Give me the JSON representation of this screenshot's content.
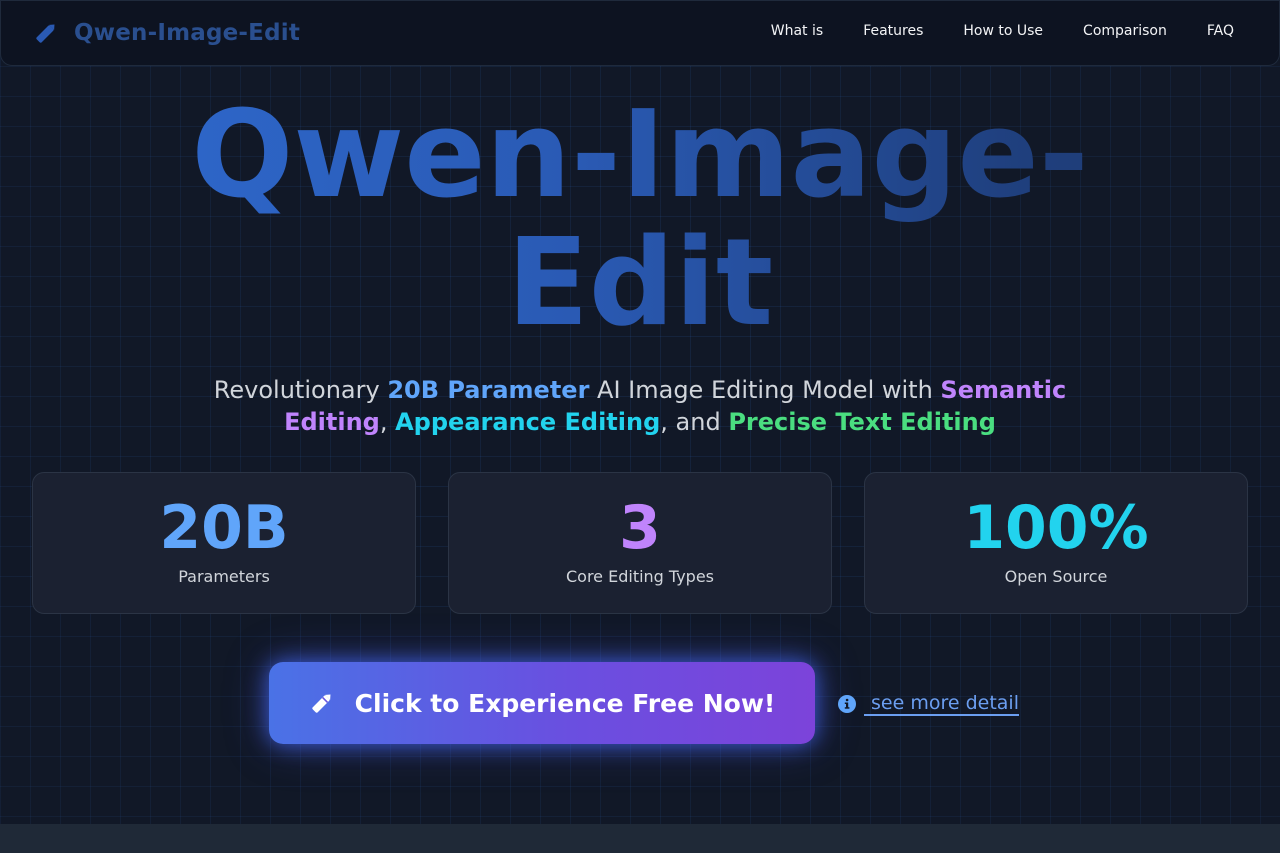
{
  "colors": {
    "accent_blue": "#60a5fa",
    "accent_purple": "#c084fc",
    "accent_cyan": "#22d3ee",
    "accent_green": "#4ade80",
    "background": "#111827",
    "brand": "#2a4f8f"
  },
  "nav": {
    "brand_icon": "pencil-icon",
    "brand": "Qwen-Image-Edit",
    "links": [
      "What is",
      "Features",
      "How to Use",
      "Comparison",
      "FAQ"
    ]
  },
  "hero": {
    "title_line1": "Qwen-Image-",
    "title_line2": "Edit",
    "subtitle": {
      "part1": "Revolutionary ",
      "highlight1": "20B Parameter",
      "part2": " AI Image Editing Model with ",
      "highlight2": "Semantic Editing",
      "part3": ", ",
      "highlight3": "Appearance Editing",
      "part4": ", and ",
      "highlight4": "Precise Text Editing"
    }
  },
  "stats": [
    {
      "value": "20B",
      "label": "Parameters",
      "color": "#60a5fa"
    },
    {
      "value": "3",
      "label": "Core Editing Types",
      "color": "#c084fc"
    },
    {
      "value": "100%",
      "label": "Open Source",
      "color": "#22d3ee"
    }
  ],
  "cta": {
    "icon": "pencil-icon",
    "label": "Click to Experience Free Now!",
    "detail_icon": "info-icon",
    "detail_link": "see more detail"
  }
}
